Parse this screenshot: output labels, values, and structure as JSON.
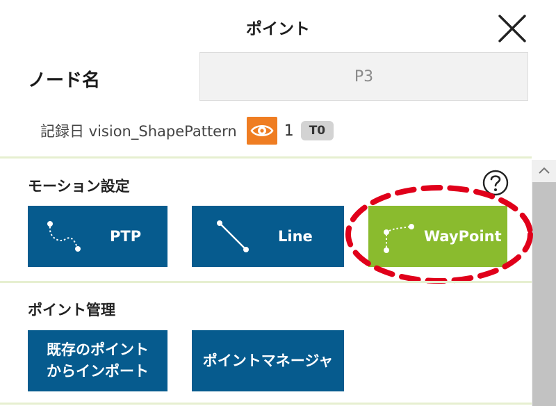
{
  "dialog": {
    "title": "ポイント",
    "close_icon": "close-icon"
  },
  "node": {
    "label": "ノード名",
    "value": "P3"
  },
  "record": {
    "text": "記録日 vision_ShapePattern",
    "eye_icon": "eye-icon",
    "eye_color": "#ef7d22",
    "count": "1",
    "tool_badge": "T0"
  },
  "motion": {
    "title": "モーション設定",
    "help_icon": "help-icon",
    "buttons": [
      {
        "label": "PTP",
        "icon": "ptp-curve-icon",
        "color": "#065b8e"
      },
      {
        "label": "Line",
        "icon": "line-icon",
        "color": "#065b8e"
      },
      {
        "label": "WayPoint",
        "icon": "waypoint-icon",
        "color": "#8abb2e"
      }
    ],
    "highlight_color": "#e0001a"
  },
  "point_management": {
    "title": "ポイント管理",
    "buttons": [
      {
        "line1": "既存のポイント",
        "line2": "からインポート"
      },
      {
        "label": "ポイントマネージャ"
      }
    ]
  }
}
